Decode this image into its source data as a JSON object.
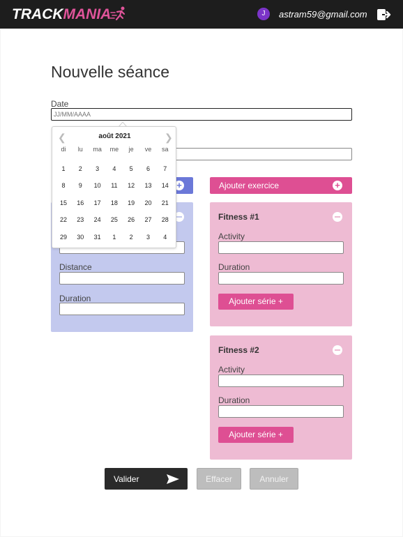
{
  "header": {
    "logo_part1": "TRACK",
    "logo_part2": "MANIA",
    "avatar_initial": "J",
    "user_email": "astram59@gmail.com"
  },
  "page": {
    "title": "Nouvelle séance",
    "date_label": "Date",
    "date_placeholder": "JJ/MM/AAAA"
  },
  "left_card": {
    "add_icon": "plus-circle-icon",
    "remove_icon": "minus-circle-icon",
    "fields": [
      "Distance",
      "Duration"
    ]
  },
  "add_exercise": {
    "label": "Ajouter exercice",
    "icon": "plus-circle-icon"
  },
  "fitness_cards": [
    {
      "title": "Fitness #1",
      "activity_label": "Activity",
      "duration_label": "Duration",
      "serie_button": "Ajouter série +"
    },
    {
      "title": "Fitness #2",
      "activity_label": "Activity",
      "duration_label": "Duration",
      "serie_button": "Ajouter série +"
    }
  ],
  "actions": {
    "submit": "Valider",
    "clear": "Effacer",
    "cancel": "Annuler"
  },
  "datepicker": {
    "month_label": "août 2021",
    "prev_icon": "chevron-left-icon",
    "next_icon": "chevron-right-icon",
    "weekdays": [
      "di",
      "lu",
      "ma",
      "me",
      "je",
      "ve",
      "sa"
    ],
    "weeks": [
      [
        "1",
        "2",
        "3",
        "4",
        "5",
        "6",
        "7"
      ],
      [
        "8",
        "9",
        "10",
        "11",
        "12",
        "13",
        "14"
      ],
      [
        "15",
        "16",
        "17",
        "18",
        "19",
        "20",
        "21"
      ],
      [
        "22",
        "23",
        "24",
        "25",
        "26",
        "27",
        "28"
      ],
      [
        "29",
        "30",
        "31",
        "1",
        "2",
        "3",
        "4"
      ]
    ]
  },
  "colors": {
    "navbar": "#1d1d1d",
    "accent_pink": "#de4f93",
    "card_pink": "#eebbd3",
    "card_blue": "#c3c9ee",
    "accent_blue": "#6b78d8",
    "avatar": "#7b34c8"
  }
}
